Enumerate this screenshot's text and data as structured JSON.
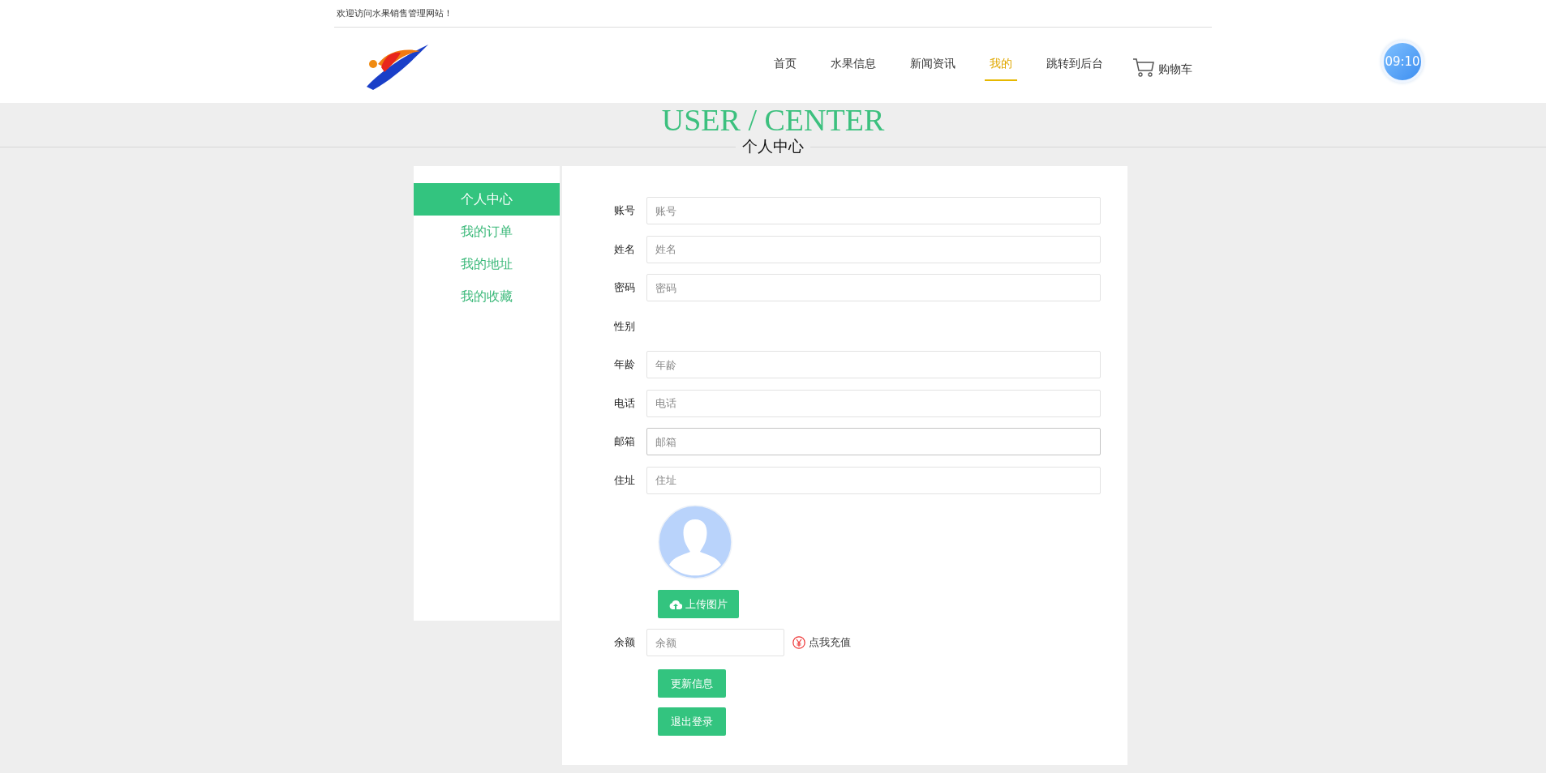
{
  "top_bar": {
    "welcome": "欢迎访问水果销售管理网站！"
  },
  "nav": {
    "items": [
      {
        "label": "首页",
        "selected": false
      },
      {
        "label": "水果信息",
        "selected": false
      },
      {
        "label": "新闻资讯",
        "selected": false
      },
      {
        "label": "我的",
        "selected": true
      },
      {
        "label": "跳转到后台",
        "selected": false
      }
    ],
    "cart": "购物车"
  },
  "clock": "09:10",
  "banner": {
    "title": "USER / CENTER",
    "subtitle": "个人中心"
  },
  "sidebar": {
    "items": [
      {
        "label": "个人中心",
        "selected": true
      },
      {
        "label": "我的订单",
        "selected": false
      },
      {
        "label": "我的地址",
        "selected": false
      },
      {
        "label": "我的收藏",
        "selected": false
      }
    ]
  },
  "form": {
    "fields": [
      {
        "label": "账号",
        "kind": "input",
        "placeholder": "账号",
        "focused": false
      },
      {
        "label": "姓名",
        "kind": "input",
        "placeholder": "姓名",
        "focused": false
      },
      {
        "label": "密码",
        "kind": "input",
        "placeholder": "密码",
        "focused": false
      },
      {
        "label": "性别",
        "kind": "empty"
      },
      {
        "label": "年龄",
        "kind": "input",
        "placeholder": "年龄",
        "focused": false
      },
      {
        "label": "电话",
        "kind": "input",
        "placeholder": "电话",
        "focused": false
      },
      {
        "label": "邮箱",
        "kind": "input",
        "placeholder": "邮箱",
        "focused": true
      },
      {
        "label": "住址",
        "kind": "input",
        "placeholder": "住址",
        "focused": false
      }
    ],
    "upload_button": "上传图片",
    "balance": {
      "label": "余额",
      "placeholder": "余额",
      "recharge": "点我充值"
    },
    "buttons": [
      "更新信息",
      "退出登录"
    ]
  }
}
